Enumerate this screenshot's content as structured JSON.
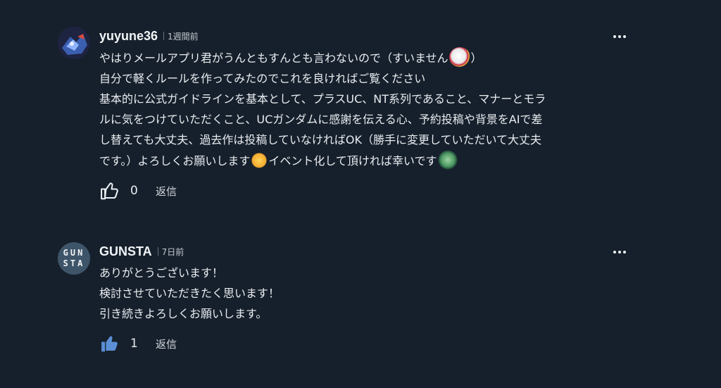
{
  "comments": [
    {
      "username": "yuyune36",
      "time": "1週間前",
      "lines": [
        "やはりメールアプリ君がうんともすんとも言わないので（すいません",
        "）",
        "自分で軽くルールを作ってみたのでこれを良ければご覧ください",
        "基本的に公式ガイドラインを基本として、プラスUC、NT系列であること、マナーとモラ",
        "ルに気をつけていただくこと、UCガンダムに感謝を伝える心、予約投稿や背景をAIで差",
        "し替えても大丈夫、過去作は投稿していなければOK（勝手に変更していただいて大丈夫",
        "です。）よろしくお願いします",
        "イベント化して頂ければ幸いです"
      ],
      "likes": "0",
      "reply_label": "返信",
      "liked": false
    },
    {
      "username": "GUNSTA",
      "time": "7日前",
      "avatar_text_top": "GUN",
      "avatar_text_bottom": "STA",
      "lines": [
        "ありがとうございます！",
        "検討させていただきたく思います！",
        "引き続きよろしくお願いします。"
      ],
      "likes": "1",
      "reply_label": "返信",
      "liked": true
    }
  ],
  "icons": {
    "more": "more-horizontal-icon",
    "like_outline": "thumbs-up-outline-icon",
    "like_filled": "thumbs-up-filled-icon"
  },
  "colors": {
    "background": "#16202c",
    "liked": "#5b8fd6"
  }
}
